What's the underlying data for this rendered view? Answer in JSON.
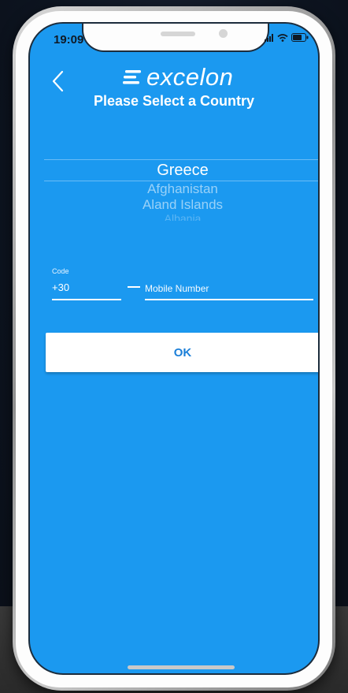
{
  "status_bar": {
    "time": "19:09"
  },
  "header": {
    "back_icon": "chevron-left-icon",
    "logo_text": "excelon",
    "title": "Please Select a Country"
  },
  "country_picker": {
    "selected": "Greece",
    "options": [
      "Afghanistan",
      "Aland Islands",
      "Albania"
    ]
  },
  "phone_form": {
    "code_label": "Code",
    "code_value": "+30",
    "mobile_placeholder": "Mobile Number"
  },
  "ok_button": {
    "label": "OK"
  },
  "colors": {
    "screen_background": "#1b99f0",
    "button_text": "#1b7fd8",
    "button_background": "#ffffff"
  }
}
